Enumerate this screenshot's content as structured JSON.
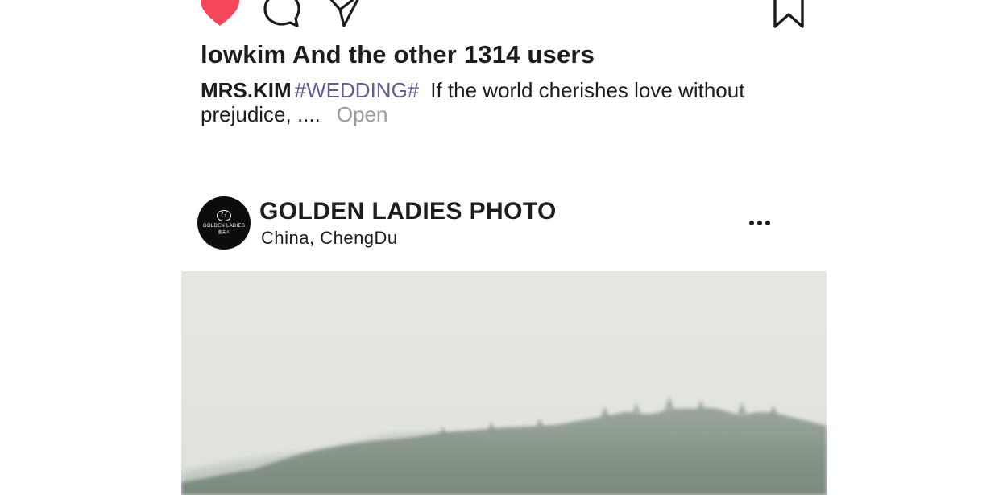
{
  "actions": {
    "like_icon": "heart-filled-icon",
    "comment_icon": "speech-bubble-icon",
    "share_icon": "send-arrow-icon",
    "save_icon": "bookmark-icon",
    "like_color": "#f5475a"
  },
  "likes": {
    "text": "lowkim And the other 1314 users"
  },
  "caption": {
    "username": "MRS.KIM",
    "hashtag": "#WEDDING#",
    "text": "If the world cherishes love without prejudice, ....",
    "more_label": "Open",
    "hashtag_color": "#5e5f95"
  },
  "post": {
    "author": "GOLDEN LADIES PHOTO",
    "location": "China,  ChengDu",
    "more_icon": "more-horizontal-icon",
    "avatar": {
      "brand": "GOLDEN LADIES",
      "sub": "金夫人",
      "monogram": "G"
    },
    "photo": "misty-forested-hills-photo"
  }
}
